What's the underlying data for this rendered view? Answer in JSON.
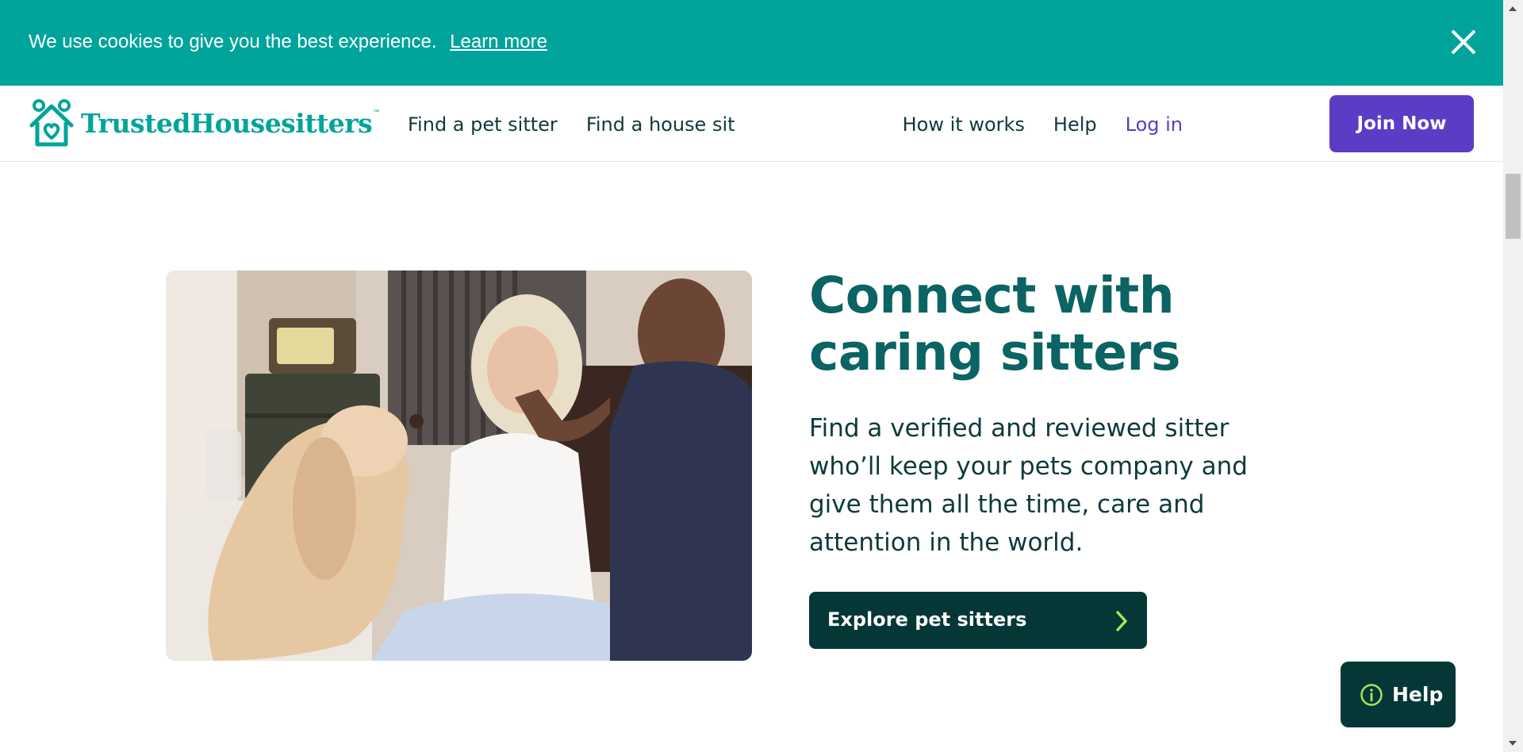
{
  "cookie_banner": {
    "message": "We use cookies to give you the best experience.",
    "learn_more": "Learn more",
    "close_icon": "close-icon"
  },
  "header": {
    "logo_text": "TrustedHousesitters",
    "logo_tm": "™",
    "logo_icon": "house-heart-icon",
    "nav_left": [
      "Find a pet sitter",
      "Find a house sit"
    ],
    "nav_right": [
      "How it works",
      "Help",
      "Log in"
    ],
    "join_button": "Join Now"
  },
  "hero": {
    "headline_line1": "Connect with",
    "headline_line2": "caring sitters",
    "body": "Find a verified and reviewed sitter who’ll keep your pets company and give them all the time, care and attention in the world.",
    "cta": "Explore pet sitters",
    "cta_icon": "chevron-right-icon"
  },
  "help_fab": {
    "label": "Help",
    "icon": "info-icon"
  },
  "colors": {
    "teal": "#00a49a",
    "dark_teal": "#063737",
    "headline": "#0b6363",
    "purple": "#5b3cc4",
    "accent_green": "#a6e35e"
  }
}
